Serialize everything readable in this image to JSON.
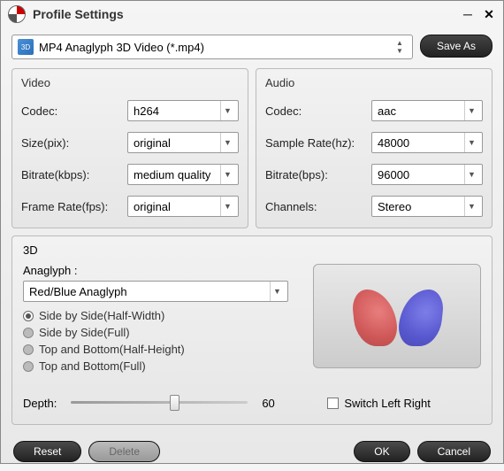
{
  "window": {
    "title": "Profile Settings"
  },
  "profile": {
    "name": "MP4 Anaglyph 3D Video (*.mp4)",
    "save_as": "Save As"
  },
  "video": {
    "title": "Video",
    "codec_label": "Codec:",
    "codec": "h264",
    "size_label": "Size(pix):",
    "size": "original",
    "bitrate_label": "Bitrate(kbps):",
    "bitrate": "medium quality",
    "fps_label": "Frame Rate(fps):",
    "fps": "original"
  },
  "audio": {
    "title": "Audio",
    "codec_label": "Codec:",
    "codec": "aac",
    "sr_label": "Sample Rate(hz):",
    "sr": "48000",
    "bitrate_label": "Bitrate(bps):",
    "bitrate": "96000",
    "channels_label": "Channels:",
    "channels": "Stereo"
  },
  "threeD": {
    "title": "3D",
    "anaglyph_label": "Anaglyph :",
    "anaglyph": "Red/Blue Anaglyph",
    "options": {
      "sbs_half": "Side by Side(Half-Width)",
      "sbs_full": "Side by Side(Full)",
      "tb_half": "Top and Bottom(Half-Height)",
      "tb_full": "Top and Bottom(Full)"
    },
    "depth_label": "Depth:",
    "depth_value": "60",
    "switch_label": "Switch Left Right"
  },
  "footer": {
    "reset": "Reset",
    "delete": "Delete",
    "ok": "OK",
    "cancel": "Cancel"
  }
}
